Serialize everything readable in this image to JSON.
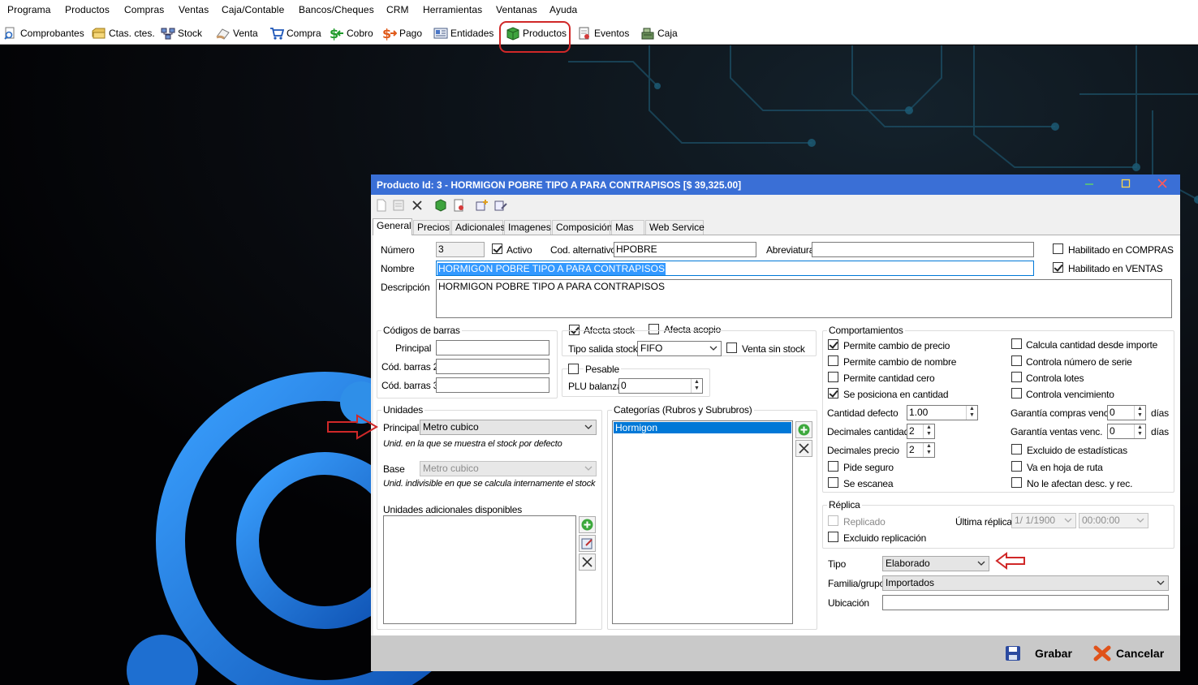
{
  "menu": [
    "Programa",
    "Productos",
    "Compras",
    "Ventas",
    "Caja/Contable",
    "Bancos/Cheques",
    "CRM",
    "Herramientas",
    "Ventanas",
    "Ayuda"
  ],
  "toolbar": [
    "Comprobantes",
    "Ctas. ctes.",
    "Stock",
    "Venta",
    "Compra",
    "Cobro",
    "Pago",
    "Entidades",
    "Productos",
    "Eventos",
    "Caja"
  ],
  "dialog": {
    "title": "Producto Id: 3 - HORMIGON POBRE TIPO A PARA CONTRAPISOS [$ 39,325.00]",
    "tabs": [
      "General",
      "Precios",
      "Adicionales",
      "Imagenes",
      "Composición",
      "Mas",
      "Web Service"
    ],
    "active_tab": "General",
    "fields": {
      "numero_label": "Número",
      "numero_value": "3",
      "activo_label": "Activo",
      "activo_checked": true,
      "cod_alt_label": "Cod. alternativo",
      "cod_alt_value": "HPOBRE",
      "abreviatura_label": "Abreviatura",
      "abreviatura_value": "",
      "hab_compras_label": "Habilitado en COMPRAS",
      "hab_compras_checked": false,
      "hab_ventas_label": "Habilitado en VENTAS",
      "hab_ventas_checked": true,
      "nombre_label": "Nombre",
      "nombre_value": "HORMIGON POBRE TIPO A PARA CONTRAPISOS",
      "descripcion_label": "Descripción",
      "descripcion_value": "HORMIGON POBRE TIPO A PARA CONTRAPISOS"
    },
    "barcodes": {
      "title": "Códigos de barras",
      "principal_label": "Principal",
      "barras2_label": "Cód. barras 2",
      "barras3_label": "Cód. barras 3"
    },
    "stock": {
      "afecta_stock": "Afecta stock",
      "afecta_acopio": "Afecta acopio",
      "tipo_salida_label": "Tipo salida stock",
      "tipo_salida_value": "FIFO",
      "venta_sin_stock": "Venta sin stock",
      "pesable": "Pesable",
      "plu_label": "PLU balanza",
      "plu_value": "0"
    },
    "unidades": {
      "title": "Unidades",
      "principal_label": "Principal",
      "principal_value": "Metro cubico",
      "principal_hint": "Unid. en la que se muestra el stock por defecto",
      "base_label": "Base",
      "base_value": "Metro cubico",
      "base_hint": "Unid. indivisible en que se calcula internamente el stock",
      "adicionales_label": "Unidades adicionales disponibles"
    },
    "categorias": {
      "title": "Categorías (Rubros y Subrubros)",
      "items": [
        "Hormigon"
      ]
    },
    "comportamientos": {
      "title": "Comportamientos",
      "left": [
        {
          "label": "Permite cambio de precio",
          "checked": true
        },
        {
          "label": "Permite cambio de nombre",
          "checked": false
        },
        {
          "label": "Permite cantidad cero",
          "checked": false
        },
        {
          "label": "Se posiciona en cantidad",
          "checked": true
        }
      ],
      "right": [
        {
          "label": "Calcula cantidad desde importe",
          "checked": false
        },
        {
          "label": "Controla número de serie",
          "checked": false
        },
        {
          "label": "Controla lotes",
          "checked": false
        },
        {
          "label": "Controla vencimiento",
          "checked": false
        }
      ],
      "cantidad_defecto_label": "Cantidad defecto",
      "cantidad_defecto_value": "1.00",
      "decimales_cantidad_label": "Decimales cantidad",
      "decimales_cantidad_value": "2",
      "decimales_precio_label": "Decimales precio",
      "decimales_precio_value": "2",
      "garantia_compras_label": "Garantía compras venc.",
      "garantia_compras_value": "0",
      "garantia_ventas_label": "Garantía ventas venc.",
      "garantia_ventas_value": "0",
      "dias": "días",
      "pide_seguro": "Pide seguro",
      "se_escanea": "Se escanea",
      "excluido_estadisticas": "Excluido de estadísticas",
      "hoja_ruta": "Va en hoja de ruta",
      "no_desc": "No le afectan desc. y rec."
    },
    "replica": {
      "title": "Réplica",
      "replicado": "Replicado",
      "ultima_label": "Última réplica:",
      "ultima_fecha": "1/  1/1900",
      "ultima_hora": "00:00:00",
      "excluido": "Excluido replicación"
    },
    "tipo_label": "Tipo",
    "tipo_value": "Elaborado",
    "familia_label": "Familia/grupo",
    "familia_value": "Importados",
    "ubicacion_label": "Ubicación",
    "ubicacion_value": "",
    "grabar": "Grabar",
    "cancelar": "Cancelar"
  },
  "colors": {
    "titlebar": "#3a6fd6",
    "selection": "#0078d7",
    "annotation": "#d02828",
    "footer": "#c9c9c9"
  }
}
